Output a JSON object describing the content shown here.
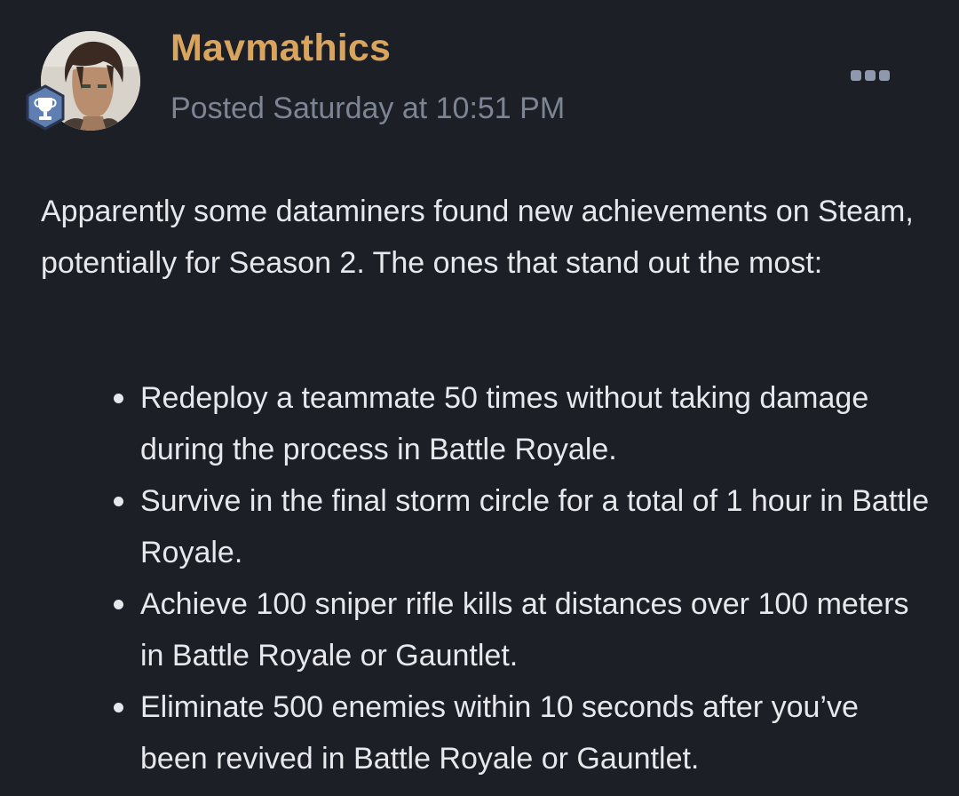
{
  "post": {
    "author": "Mavmathics",
    "posted": "Posted Saturday at 10:51 PM",
    "intro": "Apparently some dataminers found new achievements on Steam, potentially for Season 2. The ones that stand out the most:",
    "items": [
      "Redeploy a teammate 50 times without taking damage during the process in Battle Royale.",
      "Survive in the final storm circle for a total of 1 hour in Battle Royale.",
      "Achieve 100 sniper rifle kills at distances over 100 meters in Battle Royale or Gauntlet.",
      "Eliminate 500 enemies within 10 seconds after you’ve been revived in Battle Royale or Gauntlet."
    ]
  },
  "icons": {
    "badge": "trophy-badge-icon",
    "more": "more-options-icon"
  },
  "colors": {
    "background": "#1c1f26",
    "author": "#d8a45e",
    "meta": "#7d8594",
    "text": "#e6e8ec",
    "badge": "#5f7fb3"
  }
}
